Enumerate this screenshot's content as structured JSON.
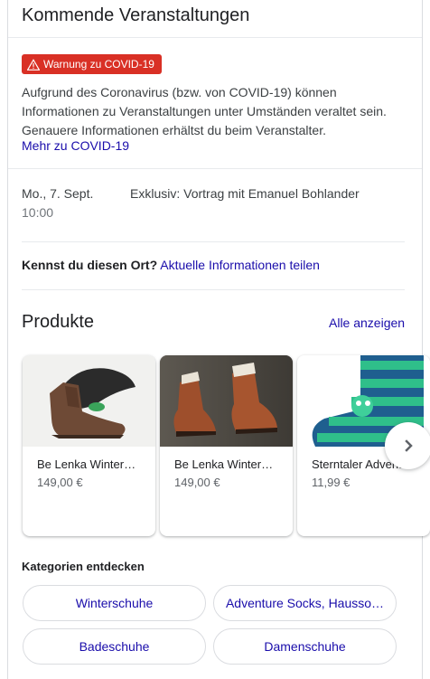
{
  "header": {
    "title": "Kommende Veranstaltungen"
  },
  "covid": {
    "badge": "Warnung zu COVID-19",
    "text": "Aufgrund des Coronavirus (bzw. von COVID-19) können Informationen zu Veranstaltungen unter Umständen veraltet sein. Genauere Informationen erhältst du beim Veranstalter.",
    "more_link": "Mehr zu COVID-19",
    "badge_color": "#d93025"
  },
  "event": {
    "date": "Mo., 7. Sept.",
    "time": "10:00",
    "title": "Exklusiv: Vortrag mit Emanuel Bohlander"
  },
  "place": {
    "question": "Kennst du diesen Ort?",
    "link": "Aktuelle Informationen teilen"
  },
  "products": {
    "heading": "Produkte",
    "all_link": "Alle anzeigen",
    "items": [
      {
        "name": "Be Lenka Winter…",
        "price": "149,00 €"
      },
      {
        "name": "Be Lenka Winter…",
        "price": "149,00 €"
      },
      {
        "name": "Sterntaler Advent…",
        "price": "11,99 €"
      }
    ]
  },
  "categories": {
    "heading": "Kategorien entdecken",
    "chips": [
      "Winterschuhe",
      "Adventure Socks, Hausso…",
      "Badeschuhe",
      "Damenschuhe"
    ]
  },
  "colors": {
    "link": "#1a0dab",
    "warning": "#d93025"
  }
}
